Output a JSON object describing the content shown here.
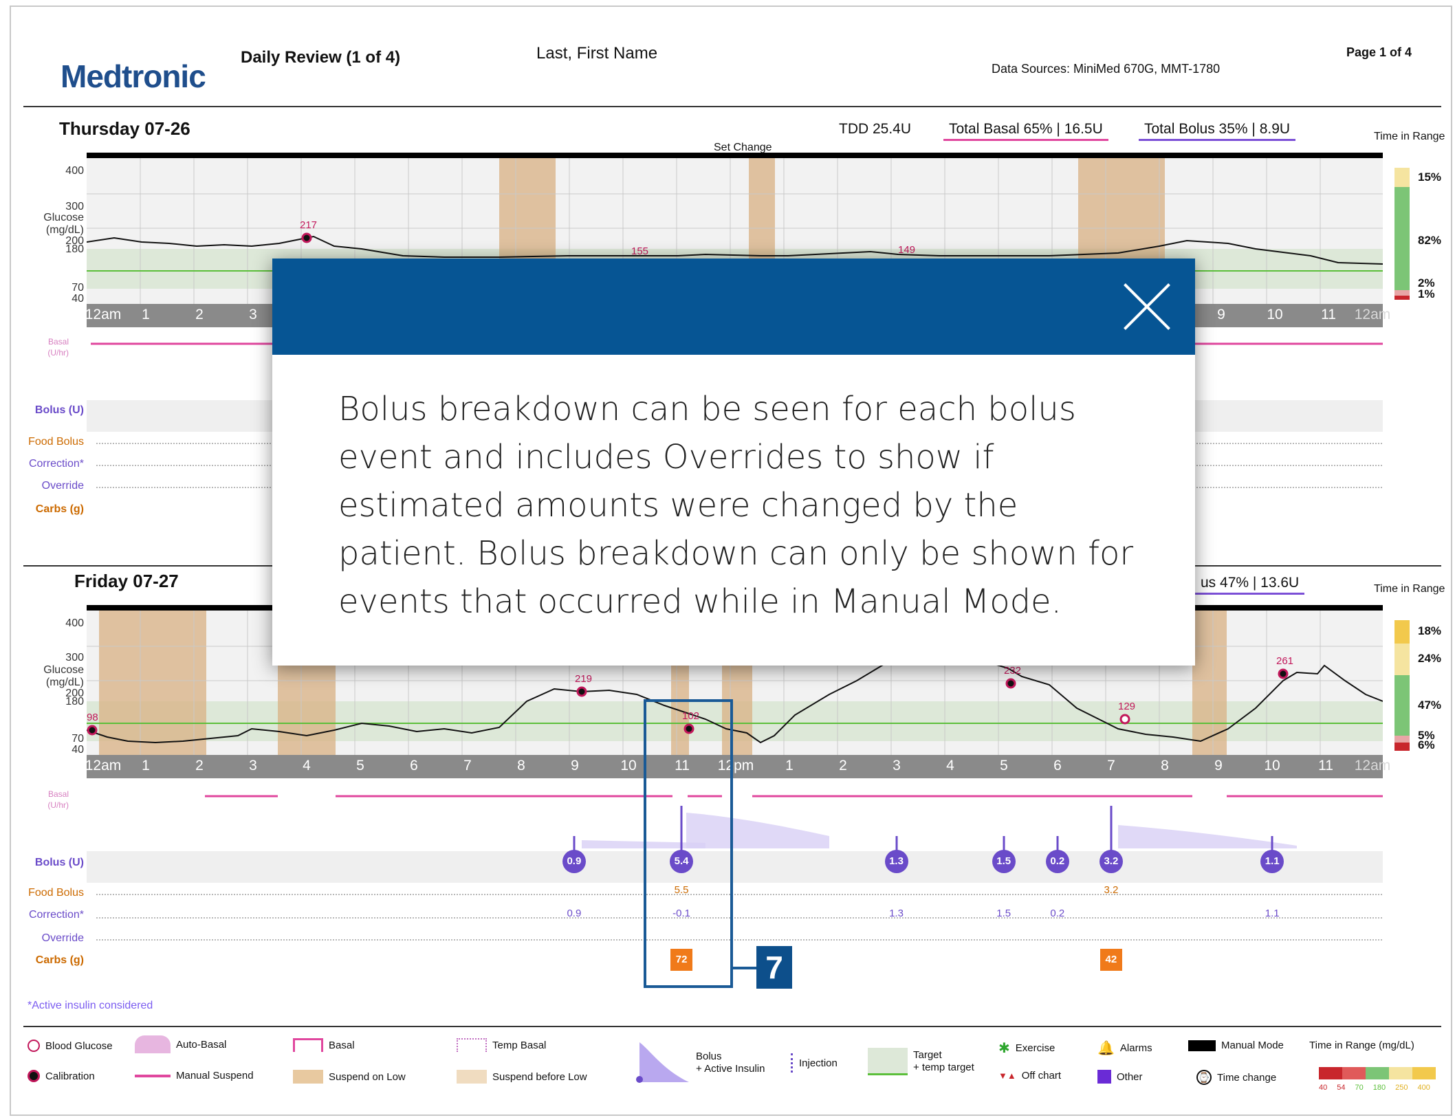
{
  "header": {
    "logo": "Medtronic",
    "report_title": "Daily Review (1 of 4)",
    "patient_name": "Last, First Name",
    "data_sources": "Data Sources: MiniMed 670G, MMT-1780",
    "page": "Page 1 of 4"
  },
  "axis": {
    "glucose_label": [
      "Glucose",
      "(mg/dL)"
    ],
    "glucose_ticks": [
      "400",
      "300",
      "200",
      "180",
      "70",
      "40"
    ],
    "basal_label": [
      "Basal",
      "(U/hr)"
    ],
    "basal_ticks": [
      "1",
      "0.8",
      "0.6",
      "0.4",
      "0.2",
      "0"
    ],
    "hours": [
      "12am",
      "1",
      "2",
      "3",
      "4",
      "5",
      "6",
      "7",
      "8",
      "9",
      "10",
      "11",
      "12pm",
      "1",
      "2",
      "3",
      "4",
      "5",
      "6",
      "7",
      "8",
      "9",
      "10",
      "11",
      "12am"
    ],
    "rows": {
      "bolus": "Bolus (U)",
      "food": "Food Bolus",
      "correction": "Correction*",
      "override": "Override",
      "carbs": "Carbs (g)"
    }
  },
  "day1": {
    "title": "Thursday 07-26",
    "tdd": "TDD 25.4U",
    "total_basal": "Total Basal 65% | 16.5U",
    "total_bolus": "Total Bolus 35% | 8.9U",
    "tir_label": "Time in Range",
    "tir": [
      "15%",
      "82%",
      "2%",
      "1%"
    ],
    "set_change": "Set Change",
    "markers": [
      "217",
      "155",
      "149"
    ]
  },
  "day2": {
    "title": "Friday 07-27",
    "total_bolus_partial": "us 47% | 13.6U",
    "tir_label": "Time in Range",
    "tir": [
      "18%",
      "24%",
      "47%",
      "5%",
      "6%"
    ],
    "markers": [
      "98",
      "219",
      "102",
      "232",
      "129",
      "261"
    ],
    "boluses": [
      {
        "hour": 9,
        "total": "0.9",
        "food": "",
        "correction": "0.9"
      },
      {
        "hour": 11,
        "total": "5.4",
        "food": "5.5",
        "correction": "-0.1"
      },
      {
        "hour": 15,
        "total": "1.3",
        "food": "",
        "correction": "1.3"
      },
      {
        "hour": 17,
        "total": "1.5",
        "food": "",
        "correction": "1.5"
      },
      {
        "hour": 18,
        "total": "0.2",
        "food": "",
        "correction": "0.2"
      },
      {
        "hour": 19,
        "total": "3.2",
        "food": "3.2",
        "correction": ""
      },
      {
        "hour": 22,
        "total": "1.1",
        "food": "",
        "correction": "1.1"
      }
    ],
    "carbs": [
      {
        "hour": 11,
        "value": "72"
      },
      {
        "hour": 19,
        "value": "42"
      }
    ]
  },
  "footnote": "*Active insulin considered",
  "callout": "7",
  "modal": {
    "text": "Bolus breakdown can be seen for each bolus event and includes Overrides to show if estimated amounts were changed by the patient. Bolus breakdown can only be shown for events that occurred while in Manual Mode."
  },
  "legend": {
    "blood_glucose": "Blood Glucose",
    "calibration": "Calibration",
    "auto_basal": "Auto-Basal",
    "manual_suspend": "Manual Suspend",
    "basal": "Basal",
    "suspend_on_low": "Suspend on Low",
    "temp_basal": "Temp Basal",
    "suspend_before_low": "Suspend before Low",
    "bolus": [
      "Bolus",
      "+ Active Insulin"
    ],
    "injection": "Injection",
    "target": [
      "Target",
      "+ temp target"
    ],
    "exercise": "Exercise",
    "off_chart": "Off chart",
    "alarms": "Alarms",
    "other": "Other",
    "manual_mode": "Manual Mode",
    "time_change": "Time change",
    "time_in_range": "Time in Range (mg/dL)",
    "range_values": [
      "40",
      "54",
      "70",
      "180",
      "250",
      "400"
    ],
    "colors": {
      "very_low": "#c8262c",
      "low": "#e05a5a",
      "in_range": "#7cc576",
      "high": "#f2c94c",
      "very_high": "#f0c040"
    }
  },
  "colors": {
    "accent": "#065594",
    "bolus": "#6a4bc9",
    "basal": "#e0479e",
    "carbs": "#f07a1a",
    "target": "#5bbf3a"
  }
}
